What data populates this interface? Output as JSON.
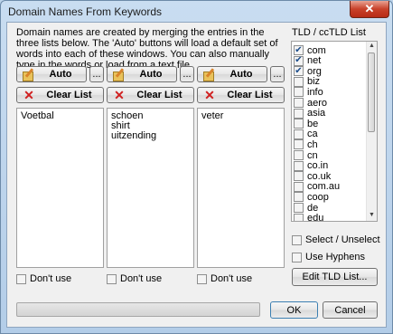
{
  "window": {
    "title": "Domain Names From Keywords",
    "close_glyph": "✕"
  },
  "description": "Domain names are created by merging the entries in the three lists below. The 'Auto' buttons will load a default set of words into each of these windows. You can also manually type in the words or load from a text file.",
  "columns": [
    {
      "auto_label": "Auto",
      "browse_label": "...",
      "clear_label": "Clear List",
      "items": [
        "Voetbal"
      ],
      "dont_use_label": "Don't use",
      "dont_use_checked": false
    },
    {
      "auto_label": "Auto",
      "browse_label": "...",
      "clear_label": "Clear List",
      "items": [
        "schoen",
        "shirt",
        "uitzending"
      ],
      "dont_use_label": "Don't use",
      "dont_use_checked": false
    },
    {
      "auto_label": "Auto",
      "browse_label": "...",
      "clear_label": "Clear List",
      "items": [
        "veter"
      ],
      "dont_use_label": "Don't use",
      "dont_use_checked": false
    }
  ],
  "tld": {
    "title": "TLD / ccTLD List",
    "items": [
      {
        "name": "com",
        "checked": true
      },
      {
        "name": "net",
        "checked": true
      },
      {
        "name": "org",
        "checked": true
      },
      {
        "name": "biz",
        "checked": false
      },
      {
        "name": "info",
        "checked": false
      },
      {
        "name": "aero",
        "checked": false
      },
      {
        "name": "asia",
        "checked": false
      },
      {
        "name": "be",
        "checked": false
      },
      {
        "name": "ca",
        "checked": false
      },
      {
        "name": "ch",
        "checked": false
      },
      {
        "name": "cn",
        "checked": false
      },
      {
        "name": "co.in",
        "checked": false
      },
      {
        "name": "co.uk",
        "checked": false
      },
      {
        "name": "com.au",
        "checked": false
      },
      {
        "name": "coop",
        "checked": false
      },
      {
        "name": "de",
        "checked": false
      },
      {
        "name": "edu",
        "checked": false
      }
    ],
    "select_unselect_label": "Select / Unselect",
    "use_hyphens_label": "Use Hyphens",
    "edit_button_label": "Edit TLD List..."
  },
  "progress": {
    "value": 0
  },
  "footer": {
    "ok_label": "OK",
    "cancel_label": "Cancel"
  },
  "icons": {
    "auto": "pencil-pad-icon",
    "clear": "red-x-icon",
    "check": "✔"
  }
}
